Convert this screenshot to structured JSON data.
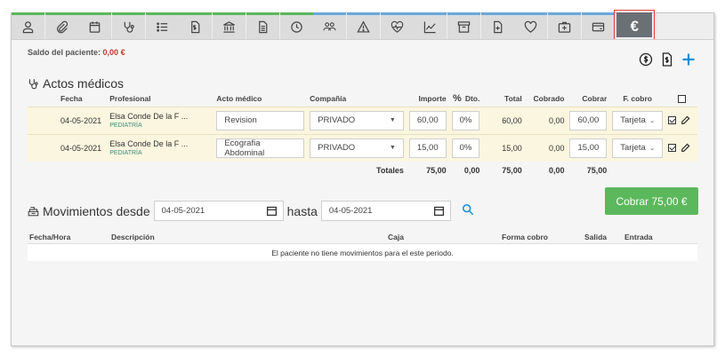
{
  "tabs": [
    {
      "icon": "user-icon",
      "color": "green"
    },
    {
      "icon": "paperclip-icon",
      "color": "green"
    },
    {
      "icon": "calendar-icon",
      "color": "green"
    },
    {
      "icon": "stethoscope-icon",
      "color": "green"
    },
    {
      "icon": "list-icon",
      "color": "green"
    },
    {
      "icon": "invoice-icon",
      "color": "green"
    },
    {
      "icon": "bank-icon",
      "color": "green"
    },
    {
      "icon": "document-icon",
      "color": "green"
    },
    {
      "icon": "clock-icon",
      "color": "green"
    },
    {
      "icon": "group-icon",
      "color": "blue"
    },
    {
      "icon": "warning-icon",
      "color": "blue"
    },
    {
      "icon": "heart-pulse-icon",
      "color": "blue"
    },
    {
      "icon": "chart-line-icon",
      "color": "blue"
    },
    {
      "icon": "archive-icon",
      "color": "blue"
    },
    {
      "icon": "file-medical-icon",
      "color": "blue"
    },
    {
      "icon": "heart-icon",
      "color": "blue"
    },
    {
      "icon": "medkit-icon",
      "color": "blue"
    },
    {
      "icon": "credit-card-icon",
      "color": "blue"
    },
    {
      "icon": "euro-icon",
      "color": "active",
      "label": "€"
    }
  ],
  "saldo": {
    "label": "Saldo del paciente:",
    "amount": "0,00 €"
  },
  "actos": {
    "title": "Actos médicos",
    "headers": {
      "fecha": "Fecha",
      "profesional": "Profesional",
      "acto": "Acto médico",
      "compania": "Compañía",
      "importe": "Importe",
      "dto_symbol": "%",
      "dto": "Dto.",
      "total": "Total",
      "cobrado": "Cobrado",
      "cobrar": "Cobrar",
      "fcobro": "F. cobro"
    },
    "rows": [
      {
        "fecha": "04-05-2021",
        "profesional": "Elsa Conde De la F ...",
        "especialidad": "PEDIATRÍA",
        "acto": "Revision",
        "compania": "PRIVADO",
        "importe": "60,00",
        "dto": "0%",
        "total": "60,00",
        "cobrado": "0,00",
        "cobrar": "60,00",
        "fcobro": "Tarjeta"
      },
      {
        "fecha": "04-05-2021",
        "profesional": "Elsa Conde De la F ...",
        "especialidad": "PEDIATRÍA",
        "acto": "Ecografia Abdominal",
        "compania": "PRIVADO",
        "importe": "15,00",
        "dto": "0%",
        "total": "15,00",
        "cobrado": "0,00",
        "cobrar": "15,00",
        "fcobro": "Tarjeta"
      }
    ],
    "totals": {
      "label": "Totales",
      "importe": "75,00",
      "dto": "0,00",
      "total": "75,00",
      "cobrado": "0,00",
      "cobrar": "75,00"
    }
  },
  "cobrar_button": "Cobrar 75,00 €",
  "movimientos": {
    "title": "Movimientos desde",
    "desde": "04-05-2021",
    "hasta_label": "hasta",
    "hasta": "04-05-2021",
    "headers": {
      "fecha_hora": "Fecha/Hora",
      "descripcion": "Descripción",
      "caja": "Caja",
      "forma_cobro": "Forma cobro",
      "salida": "Salida",
      "entrada": "Entrada"
    },
    "empty_message": "El paciente no tiene movimientos para el este periodo."
  },
  "colors": {
    "green": "#5cb85c",
    "blue": "#6aa8dc",
    "danger": "#c0392b",
    "row_bg": "#fbf6df"
  }
}
